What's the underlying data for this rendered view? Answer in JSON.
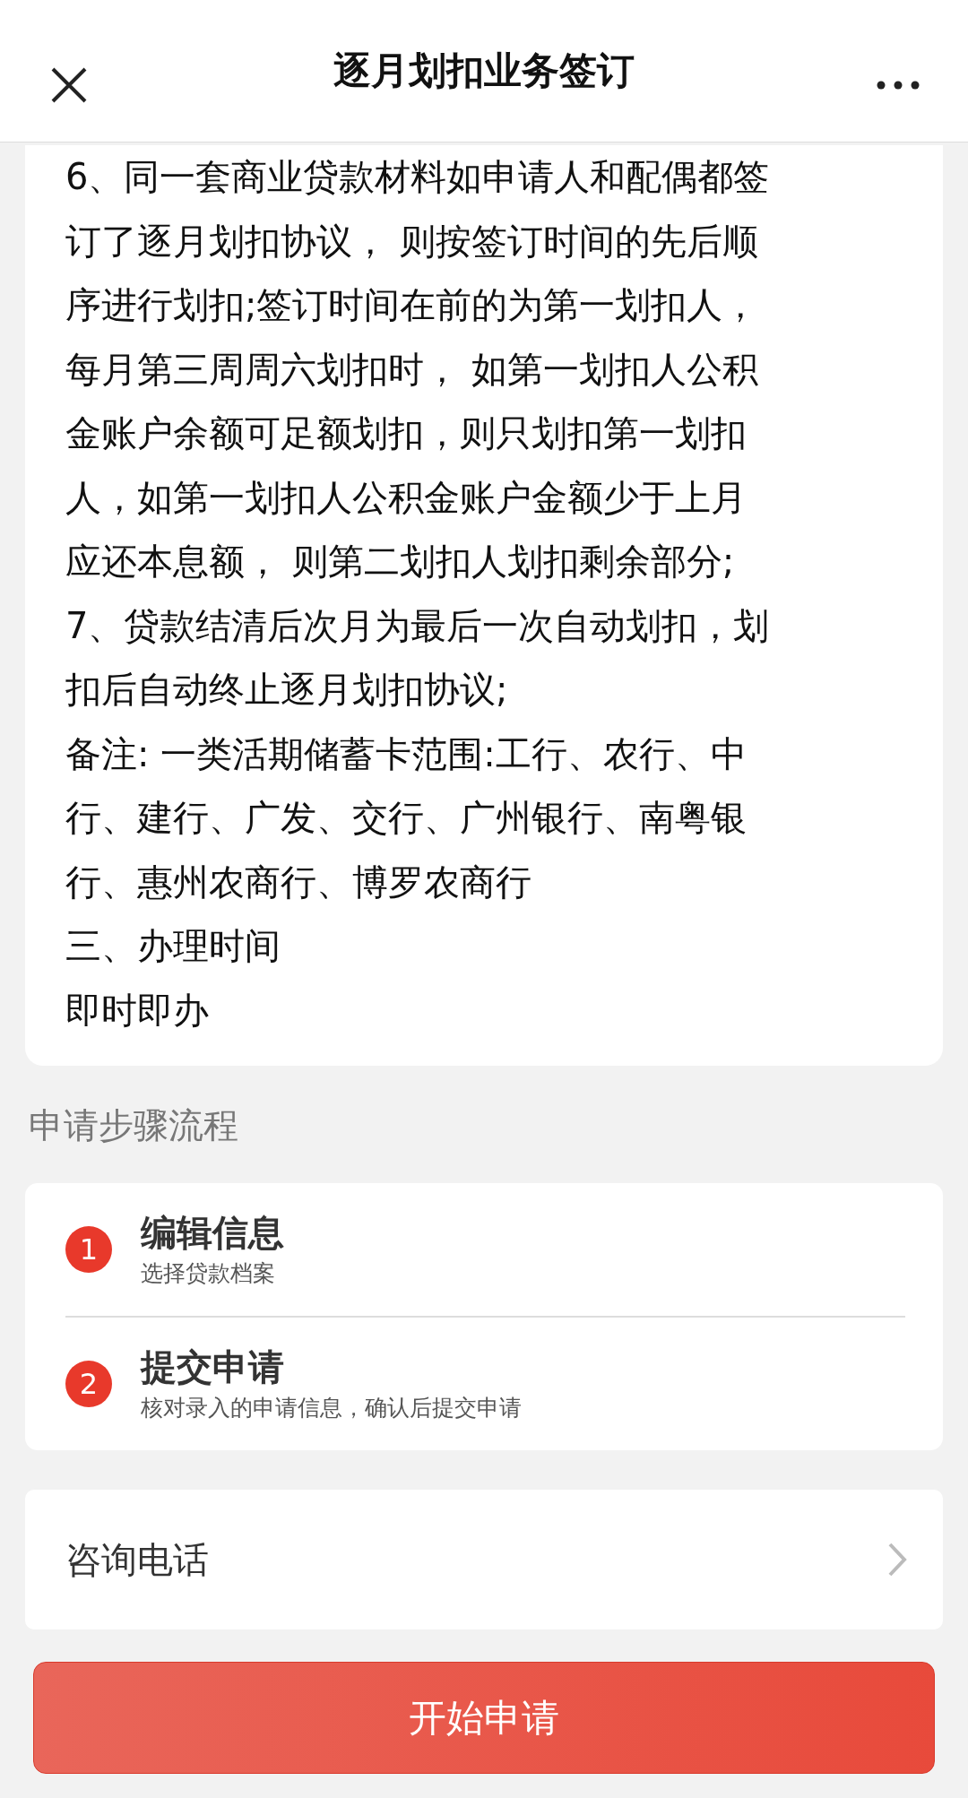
{
  "header": {
    "title": "逐月划扣业务签订"
  },
  "notice": {
    "lines": [
      "6、同一套商业贷款材料如申请人和配偶都签",
      "订了逐月划扣协议， 则按签订时间的先后顺",
      "序进行划扣;签订时间在前的为第一划扣人，",
      "每月第三周周六划扣时， 如第一划扣人公积",
      "金账户余额可足额划扣，则只划扣第一划扣",
      "人，如第一划扣人公积金账户金额少于上月",
      "应还本息额， 则第二划扣人划扣剩余部分;",
      "7、贷款结清后次月为最后一次自动划扣，划",
      "扣后自动终止逐月划扣协议;",
      "备注: 一类活期储蓄卡范围:工行、农行、中",
      "行、建行、广发、交行、广州银行、南粤银",
      "行、惠州农商行、博罗农商行",
      "三、办理时间",
      "即时即办"
    ]
  },
  "steps_section": {
    "label": "申请步骤流程",
    "steps": [
      {
        "number": "1",
        "title": "编辑信息",
        "subtitle": "选择贷款档案"
      },
      {
        "number": "2",
        "title": "提交申请",
        "subtitle": "核对录入的申请信息，确认后提交申请"
      }
    ]
  },
  "consult": {
    "label": "咨询电话"
  },
  "primary_button": {
    "label": "开始申请"
  }
}
